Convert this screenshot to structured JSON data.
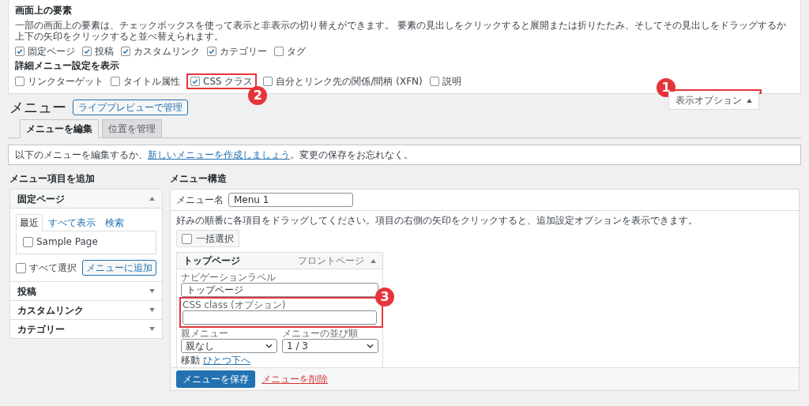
{
  "screen_options": {
    "heading": "画面上の要素",
    "description": "一部の画面上の要素は、チェックボックスを使って表示と非表示の切り替えができます。 要素の見出しをクリックすると展開または折りたたみ、そしてその見出しをドラッグするか上下の矢印をクリックすると並べ替えられます。",
    "boxes": [
      {
        "label": "固定ページ",
        "checked": true
      },
      {
        "label": "投稿",
        "checked": true
      },
      {
        "label": "カスタムリンク",
        "checked": true
      },
      {
        "label": "カテゴリー",
        "checked": true
      },
      {
        "label": "タグ",
        "checked": false
      }
    ],
    "advanced_heading": "詳細メニュー設定を表示",
    "advanced": [
      {
        "label": "リンクターゲット",
        "checked": false
      },
      {
        "label": "タイトル属性",
        "checked": false
      },
      {
        "label": "CSS クラス",
        "checked": true,
        "annotation": "2"
      },
      {
        "label": "自分とリンク先の関係/間柄 (XFN)",
        "checked": false
      },
      {
        "label": "説明",
        "checked": false
      }
    ]
  },
  "screen_options_button": {
    "label": "表示オプション",
    "expanded": true,
    "annotation": "1"
  },
  "page_title": "メニュー",
  "live_preview_button": "ライブプレビューで管理",
  "tabs": [
    {
      "label": "メニューを編集",
      "selected": true
    },
    {
      "label": "位置を管理",
      "selected": false
    }
  ],
  "notice": {
    "before": "以下のメニューを編集するか、",
    "link": "新しいメニューを作成しましょう",
    "after": "。変更の保存をお忘れなく。"
  },
  "add_items": {
    "heading": "メニュー項目を追加",
    "sections": [
      {
        "title": "固定ページ",
        "expanded": true,
        "tabs": [
          {
            "label": "最近",
            "selected": true
          },
          {
            "label": "すべて表示",
            "selected": false
          },
          {
            "label": "検索",
            "selected": false
          }
        ],
        "items": [
          {
            "label": "Sample Page",
            "checked": false
          }
        ],
        "select_all": {
          "label": "すべて選択",
          "checked": false
        },
        "add_button": "メニューに追加"
      },
      {
        "title": "投稿",
        "expanded": false
      },
      {
        "title": "カスタムリンク",
        "expanded": false
      },
      {
        "title": "カテゴリー",
        "expanded": false
      }
    ]
  },
  "structure": {
    "heading": "メニュー構造",
    "name_label": "メニュー名",
    "name_value": "Menu 1",
    "instructions": "好みの順番に各項目をドラッグしてください。項目の右側の矢印をクリックすると、追加設定オプションを表示できます。",
    "bulk_select": {
      "label": "一括選択",
      "checked": false
    },
    "items": [
      {
        "title": "トップページ",
        "type": "フロントページ",
        "expanded": true,
        "nav_label_caption": "ナビゲーションラベル",
        "nav_label_value": "トップページ",
        "css_caption": "CSS class (オプション)",
        "css_annotation": "3",
        "parent_caption": "親メニュー",
        "parent_value": "親なし",
        "order_caption": "メニューの並び順",
        "order_value": "1 / 3",
        "move_label": "移動",
        "move_link": "ひとつ下へ"
      }
    ],
    "save_button": "メニューを保存",
    "delete_link": "メニューを削除"
  }
}
